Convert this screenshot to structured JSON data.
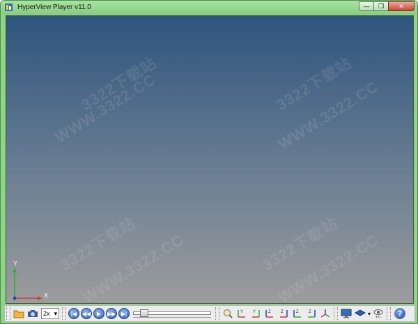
{
  "window": {
    "title": "HyperView Player v11.0"
  },
  "viewport": {
    "watermarks": [
      "WWW.3322.CC",
      "3322下载站",
      "WWW.3322.CC",
      "3322下载站",
      "WWW.3322.CC",
      "3322下载站",
      "WWW.3322.CC",
      "3322下载站"
    ],
    "axes": {
      "x_label": "X",
      "y_label": "Y"
    }
  },
  "toolbar": {
    "speed_value": "2x",
    "animation_fraction": 0.1,
    "icons": [
      "open-file-icon",
      "capture-icon",
      "first-frame-icon",
      "previous-frame-icon",
      "play-icon",
      "next-frame-icon",
      "last-frame-icon",
      "fit-view-icon",
      "view-xy-icon",
      "view-xy-reverse-icon",
      "view-zx-icon",
      "view-zx-reverse-icon",
      "view-yz-icon",
      "view-yz-reverse-icon",
      "isometric-view-icon",
      "display-icon",
      "layer-icon",
      "visibility-icon",
      "help-icon"
    ],
    "help_label": "?"
  }
}
